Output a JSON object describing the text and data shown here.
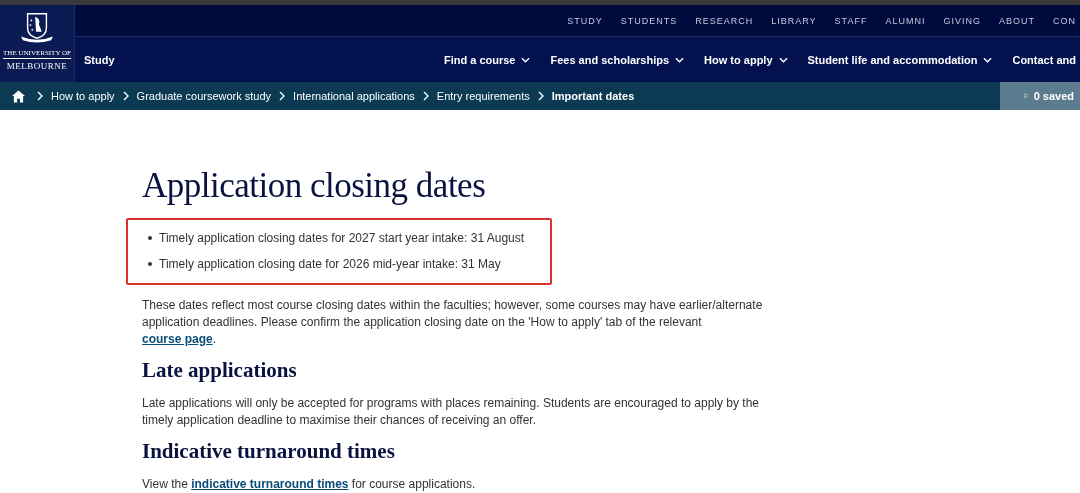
{
  "logo": {
    "line_1": "THE UNIVERSITY OF",
    "line_2": "MELBOURNE"
  },
  "top_links": [
    "STUDY",
    "STUDENTS",
    "RESEARCH",
    "LIBRARY",
    "STAFF",
    "ALUMNI",
    "GIVING",
    "ABOUT",
    "CON"
  ],
  "section_title": "Study",
  "main_nav": [
    {
      "label": "Find a course",
      "dropdown": true
    },
    {
      "label": "Fees and scholarships",
      "dropdown": true
    },
    {
      "label": "How to apply",
      "dropdown": true
    },
    {
      "label": "Student life and accommodation",
      "dropdown": true
    },
    {
      "label": "Contact and",
      "dropdown": false
    }
  ],
  "breadcrumb": [
    {
      "label": "How to apply",
      "current": false
    },
    {
      "label": "Graduate coursework study",
      "current": false
    },
    {
      "label": "International applications",
      "current": false
    },
    {
      "label": "Entry requirements",
      "current": false
    },
    {
      "label": "Important dates",
      "current": true
    }
  ],
  "saved_button": "0 saved",
  "content": [
    {
      "kind": "h1",
      "text": "Application closing dates"
    },
    {
      "kind": "bullets",
      "highlighted": true,
      "items": [
        "Timely application closing dates for 2027 start year intake: 31 August",
        "Timely application closing date for 2026 mid-year intake: 31 May"
      ]
    },
    {
      "kind": "p",
      "before": "These dates reflect most course closing dates within the faculties; however, some courses may have earlier/alternate application deadlines. Please confirm the application closing date on the 'How to apply' tab of the relevant ",
      "link": "course page",
      "after": "."
    },
    {
      "kind": "h2",
      "text": "Late applications"
    },
    {
      "kind": "p",
      "before": "Late applications will only be accepted for programs with places remaining. Students are encouraged to apply by the timely application deadline to maximise their chances of receiving an offer."
    },
    {
      "kind": "h2",
      "text": "Indicative turnaround times"
    },
    {
      "kind": "p",
      "before": "View the ",
      "link": "indicative turnaround times",
      "after": " for course applications."
    }
  ]
}
